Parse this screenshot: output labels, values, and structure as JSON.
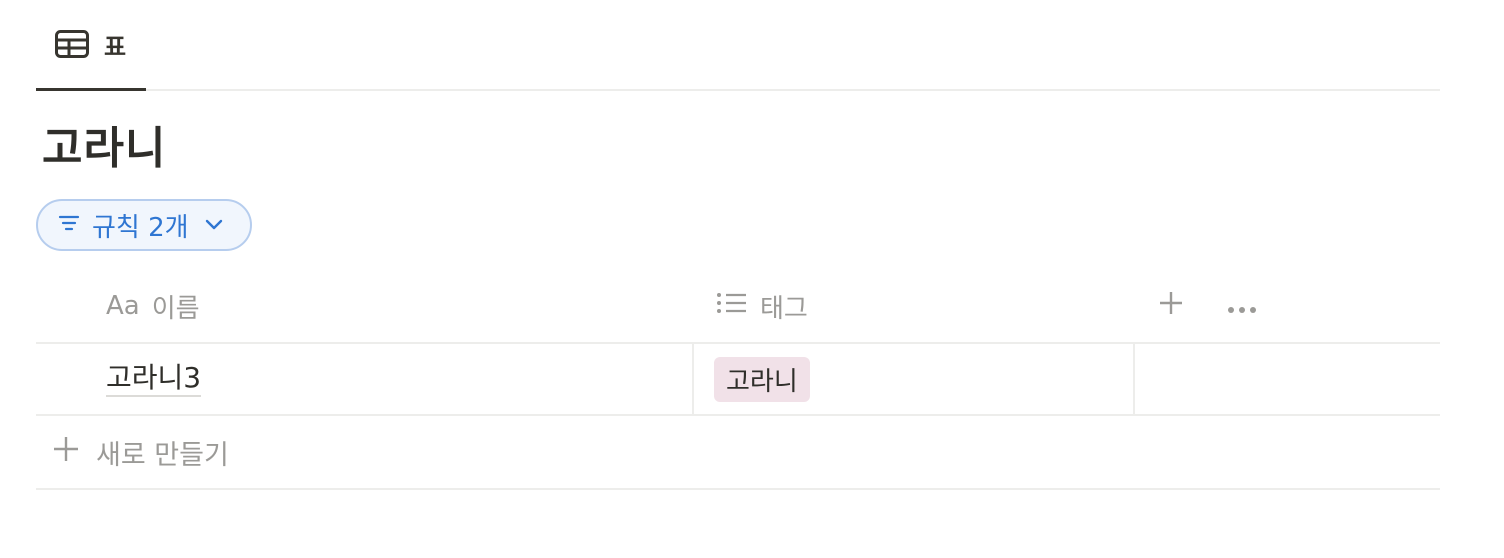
{
  "tabs": [
    {
      "label": "표",
      "icon": "table-icon",
      "active": true
    }
  ],
  "title": "고라니",
  "filter": {
    "label": "규칙 2개",
    "icon": "filter-lines-icon"
  },
  "table": {
    "columns": [
      {
        "label": "이름",
        "prefix": "Aa",
        "icon": "text-property-icon"
      },
      {
        "label": "태그",
        "icon": "list-property-icon"
      }
    ],
    "add_column_icon": "plus-icon",
    "more_icon": "more-horizontal-icon",
    "rows": [
      {
        "name": "고라니3",
        "tag": "고라니"
      }
    ],
    "new_row_label": "새로 만들기"
  },
  "colors": {
    "accent": "#2f76d2",
    "pill_border": "#b6cdee",
    "pill_bg": "#f1f6fd",
    "tag_bg": "#f1e1e8",
    "muted": "#9b9a97",
    "text": "#37352f",
    "divider": "#ededeb"
  }
}
